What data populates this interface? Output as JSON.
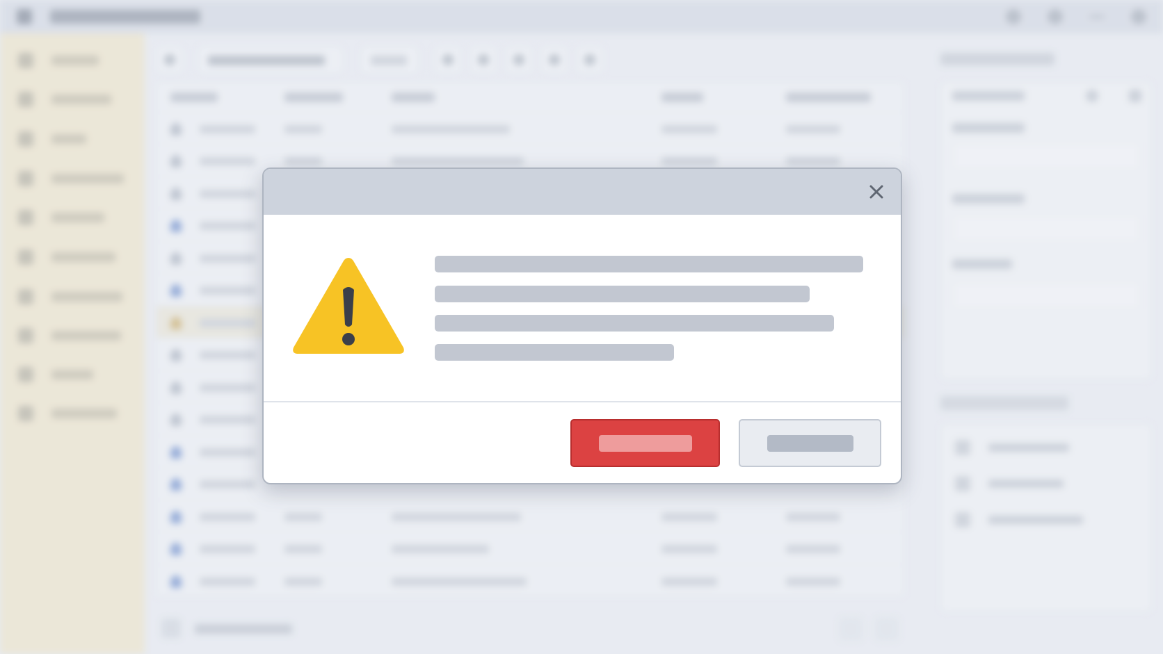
{
  "app": {
    "window_icon": "document-icon",
    "sidebar_item_count": 10,
    "table_row_count": 15
  },
  "dialog": {
    "type": "warning",
    "header": "",
    "message": "",
    "icon": "warning-triangle-icon",
    "close_icon": "close-icon",
    "primary_button_label": "",
    "secondary_button_label": ""
  },
  "colors": {
    "dialog_header": "#cdd3dd",
    "warning_yellow": "#f7c325",
    "warning_glyph": "#3a3f4a",
    "danger_button": "#dc4242",
    "secondary_button": "#e9ecf1",
    "sidebar": "#ece3c9"
  }
}
